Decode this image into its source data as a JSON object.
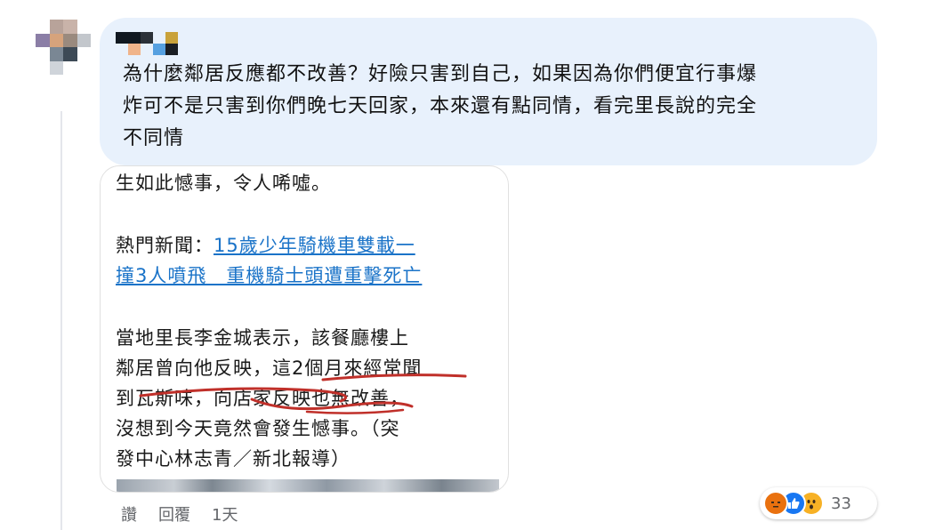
{
  "comment": {
    "text_line1": "為什麼鄰居反應都不改善？好險只害到自己，如果因為你們便宜行事爆",
    "text_line2": "炸可不是只害到你們晚七天回家，本來還有點同情，看完里長說的完全",
    "text_line3": "不同情"
  },
  "attachment": {
    "line1": "生如此憾事，令人唏噓。",
    "news_prefix": "熱門新聞：",
    "news_link_line1": "15歲少年騎機車雙載一",
    "news_link_line2": "撞3人噴飛　重機騎士頭遭重擊死亡",
    "body_line1": "當地里長李金城表示，該餐廳樓上",
    "body_line2": "鄰居曾向他反映，這2個月來經常聞",
    "body_line3": "到瓦斯味，向店家反映也無改善，",
    "body_line4": "沒想到今天竟然會發生憾事。（突",
    "body_line5": "發中心林志青／新北報導）"
  },
  "actions": {
    "like_label": "讚",
    "reply_label": "回覆",
    "time_label": "1天"
  },
  "reactions": {
    "icons": [
      "angry-icon",
      "like-icon",
      "wow-icon"
    ],
    "count": "33"
  },
  "colors": {
    "bubble": "#e8f1fc",
    "link": "#1a73c8",
    "pen": "#c0302a",
    "meta": "#65676b"
  }
}
